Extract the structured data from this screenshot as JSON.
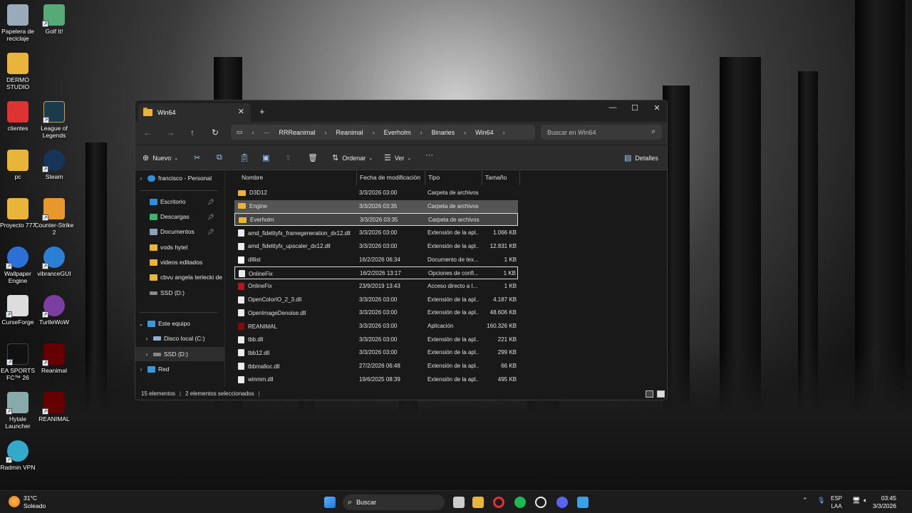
{
  "desktop": {
    "icons": [
      {
        "label": "Papelera de reciclaje",
        "icon": "recycle-bin-icon",
        "color": "#9ab"
      },
      {
        "label": "Golf It!",
        "icon": "golf-it-icon",
        "color": "#5a7"
      },
      {
        "label": "DERMO STUDIO",
        "icon": "folder-icon",
        "color": "#e8b53a"
      },
      {
        "label": "clientes",
        "icon": "folder-icon",
        "color": "#d33"
      },
      {
        "label": "League of Legends",
        "icon": "league-icon",
        "color": "#1b3a4a"
      },
      {
        "label": "pc",
        "icon": "folder-icon",
        "color": "#e8b53a"
      },
      {
        "label": "Steam",
        "icon": "steam-icon",
        "color": "#17345a"
      },
      {
        "label": "Proyecto 777",
        "icon": "folder-icon",
        "color": "#e8b53a"
      },
      {
        "label": "Counter-Strike 2",
        "icon": "cs2-icon",
        "color": "#e8982a"
      },
      {
        "label": "Wallpaper Engine",
        "icon": "wallpaper-engine-icon",
        "color": "#2c6fd6"
      },
      {
        "label": "vibranceGUI",
        "icon": "vibrance-icon",
        "color": "#2b7fd4"
      },
      {
        "label": "CurseForge",
        "icon": "curseforge-icon",
        "color": "#ddd"
      },
      {
        "label": "TurtleWoW",
        "icon": "turtlewow-icon",
        "color": "#7a3fa0"
      },
      {
        "label": "EA SPORTS FC™ 26",
        "icon": "ea-fc-icon",
        "color": "#111"
      },
      {
        "label": "Reanimal",
        "icon": "reanimal-icon",
        "color": "#600"
      },
      {
        "label": "Hytale Launcher",
        "icon": "hytale-icon",
        "color": "#8aa"
      },
      {
        "label": "REANIMAL",
        "icon": "reanimal-icon",
        "color": "#600"
      },
      {
        "label": "Radmin VPN",
        "icon": "radmin-vpn-icon",
        "color": "#3ac"
      }
    ]
  },
  "explorer": {
    "tab_title": "Win64",
    "breadcrumb": [
      "RRReanimal",
      "Reanimal",
      "Everholm",
      "Binaries",
      "Win64"
    ],
    "search_placeholder": "Buscar en Win64",
    "toolbar": {
      "new_label": "Nuevo",
      "sort_label": "Ordenar",
      "view_label": "Ver",
      "more_label": "···",
      "details_label": "Detalles"
    },
    "sidebar": {
      "onedrive": "francisco - Personal",
      "quick": [
        {
          "label": "Escritorio",
          "pinned": true,
          "color": "#2f8fdc"
        },
        {
          "label": "Descargas",
          "pinned": true,
          "color": "#3bb36a"
        },
        {
          "label": "Documentos",
          "pinned": true,
          "color": "#8ea0b8"
        },
        {
          "label": "vods hytel",
          "pinned": false,
          "color": "#e8b53a"
        },
        {
          "label": "videos editados",
          "pinned": false,
          "color": "#e8b53a"
        },
        {
          "label": "cbvu angela terlecki de",
          "pinned": false,
          "color": "#e8b53a"
        },
        {
          "label": "SSD (D:)",
          "pinned": false,
          "color": "#888"
        }
      ],
      "this_pc": "Este equipo",
      "drives": [
        "Disco local (C:)",
        "SSD (D:)"
      ],
      "network": "Red"
    },
    "columns": {
      "name": "Nombre",
      "date": "Fecha de modificación",
      "type": "Tipo",
      "size": "Tamaño"
    },
    "files": [
      {
        "name": "D3D12",
        "date": "3/3/2026 03:00",
        "type": "Carpeta de archivos",
        "size": "",
        "kind": "folder"
      },
      {
        "name": "Engine",
        "date": "3/3/2026 03:35",
        "type": "Carpeta de archivos",
        "size": "",
        "kind": "folder"
      },
      {
        "name": "Everholm",
        "date": "3/3/2026 03:35",
        "type": "Carpeta de archivos",
        "size": "",
        "kind": "folder"
      },
      {
        "name": "amd_fidelityfx_framegeneration_dx12.dll",
        "date": "3/3/2026 03:00",
        "type": "Extensión de la apl...",
        "size": "1.066 KB",
        "kind": "dll"
      },
      {
        "name": "amd_fidelityfx_upscaler_dx12.dll",
        "date": "3/3/2026 03:00",
        "type": "Extensión de la apl...",
        "size": "12.831 KB",
        "kind": "dll"
      },
      {
        "name": "dlllist",
        "date": "16/2/2026 06:34",
        "type": "Documento de tex...",
        "size": "1 KB",
        "kind": "doc"
      },
      {
        "name": "OnlineFix",
        "date": "16/2/2026 13:17",
        "type": "Opciones de confi...",
        "size": "1 KB",
        "kind": "dll"
      },
      {
        "name": "OnlineFix",
        "date": "23/9/2019 13:43",
        "type": "Acceso directo a I...",
        "size": "1 KB",
        "kind": "lnk"
      },
      {
        "name": "OpenColorIO_2_3.dll",
        "date": "3/3/2026 03:00",
        "type": "Extensión de la apl...",
        "size": "4.187 KB",
        "kind": "dll"
      },
      {
        "name": "OpenImageDenoise.dll",
        "date": "3/3/2026 03:00",
        "type": "Extensión de la apl...",
        "size": "48.606 KB",
        "kind": "dll"
      },
      {
        "name": "REANIMAL",
        "date": "3/3/2026 03:00",
        "type": "Aplicación",
        "size": "160.326 KB",
        "kind": "app"
      },
      {
        "name": "tbb.dll",
        "date": "3/3/2026 03:00",
        "type": "Extensión de la apl...",
        "size": "221 KB",
        "kind": "dll"
      },
      {
        "name": "tbb12.dll",
        "date": "3/3/2026 03:00",
        "type": "Extensión de la apl...",
        "size": "299 KB",
        "kind": "dll"
      },
      {
        "name": "tbbmalloc.dll",
        "date": "27/2/2026 06:48",
        "type": "Extensión de la apl...",
        "size": "66 KB",
        "kind": "dll"
      },
      {
        "name": "winmm.dll",
        "date": "19/6/2025 08:39",
        "type": "Extensión de la apl...",
        "size": "495 KB",
        "kind": "dll"
      }
    ],
    "selected_rows": [
      1,
      2
    ],
    "focused_row": 6,
    "status": {
      "count": "15 elementos",
      "selection": "2 elementos seleccionados"
    }
  },
  "taskbar": {
    "weather_temp": "31°C",
    "weather_desc": "Soleado",
    "search_placeholder": "Buscar",
    "lang_top": "ESP",
    "lang_bottom": "LAA",
    "time": "03:45",
    "date": "3/3/2026",
    "apps": [
      {
        "icon": "windows-start-icon",
        "color": "#3b9cf0"
      },
      {
        "icon": "task-view-icon",
        "color": "#ccc"
      },
      {
        "icon": "file-explorer-icon",
        "color": "#e8b53a"
      },
      {
        "icon": "opera-gx-icon",
        "color": "#e0303a"
      },
      {
        "icon": "spotify-icon",
        "color": "#1db954"
      },
      {
        "icon": "chatgpt-icon",
        "color": "#eee"
      },
      {
        "icon": "discord-icon",
        "color": "#5865f2"
      },
      {
        "icon": "photos-icon",
        "color": "#3aa0e8"
      }
    ]
  }
}
